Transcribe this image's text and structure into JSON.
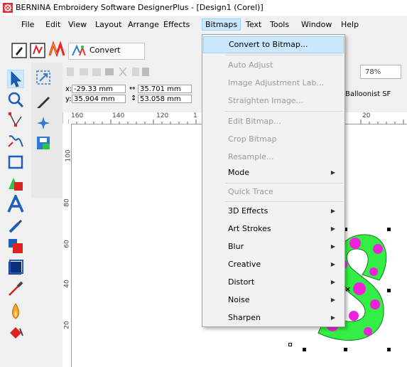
{
  "window": {
    "title": "BERNINA Embroidery Software DesignerPlus - [Design1 (Corel)]"
  },
  "menubar": {
    "items": [
      "File",
      "Edit",
      "View",
      "Layout",
      "Arrange",
      "Effects",
      "Bitmaps",
      "Text",
      "Tools",
      "Window",
      "Help"
    ],
    "active": "Bitmaps"
  },
  "toolbar": {
    "convert_label": "Convert"
  },
  "propbar": {
    "x_label": "x:",
    "x_value": "-29.33 mm",
    "y_label": "y:",
    "y_value": "35.904 mm",
    "w_value": "35.701 mm",
    "h_value": "53.058 mm",
    "zoom": "78%",
    "font": "Balloonist SF"
  },
  "ruler": {
    "h_ticks": [
      "160",
      "140",
      "120",
      "1",
      "20"
    ],
    "v_ticks": [
      "100",
      "80",
      "60",
      "40",
      "20"
    ]
  },
  "bitmaps_menu": {
    "items": [
      {
        "label": "Convert to Bitmap...",
        "enabled": true,
        "highlighted": true,
        "submenu": false
      },
      {
        "label": "Auto Adjust",
        "enabled": false,
        "submenu": false
      },
      {
        "label": "Image Adjustment Lab...",
        "enabled": false,
        "submenu": false
      },
      {
        "label": "Straighten Image...",
        "enabled": false,
        "submenu": false
      },
      {
        "label": "Edit Bitmap...",
        "enabled": false,
        "submenu": false
      },
      {
        "label": "Crop Bitmap",
        "enabled": false,
        "submenu": false
      },
      {
        "label": "Resample...",
        "enabled": false,
        "submenu": false
      },
      {
        "label": "Mode",
        "enabled": true,
        "submenu": true
      },
      {
        "label": "Quick Trace",
        "enabled": false,
        "submenu": false
      },
      {
        "label": "3D Effects",
        "enabled": true,
        "submenu": true
      },
      {
        "label": "Art Strokes",
        "enabled": true,
        "submenu": true
      },
      {
        "label": "Blur",
        "enabled": true,
        "submenu": true
      },
      {
        "label": "Creative",
        "enabled": true,
        "submenu": true
      },
      {
        "label": "Distort",
        "enabled": true,
        "submenu": true
      },
      {
        "label": "Noise",
        "enabled": true,
        "submenu": true
      },
      {
        "label": "Sharpen",
        "enabled": true,
        "submenu": true
      }
    ]
  },
  "colors": {
    "menu_highlight": "#cce8ff",
    "letter_fill": "#33ee44",
    "letter_dots": "#ee22dd"
  }
}
